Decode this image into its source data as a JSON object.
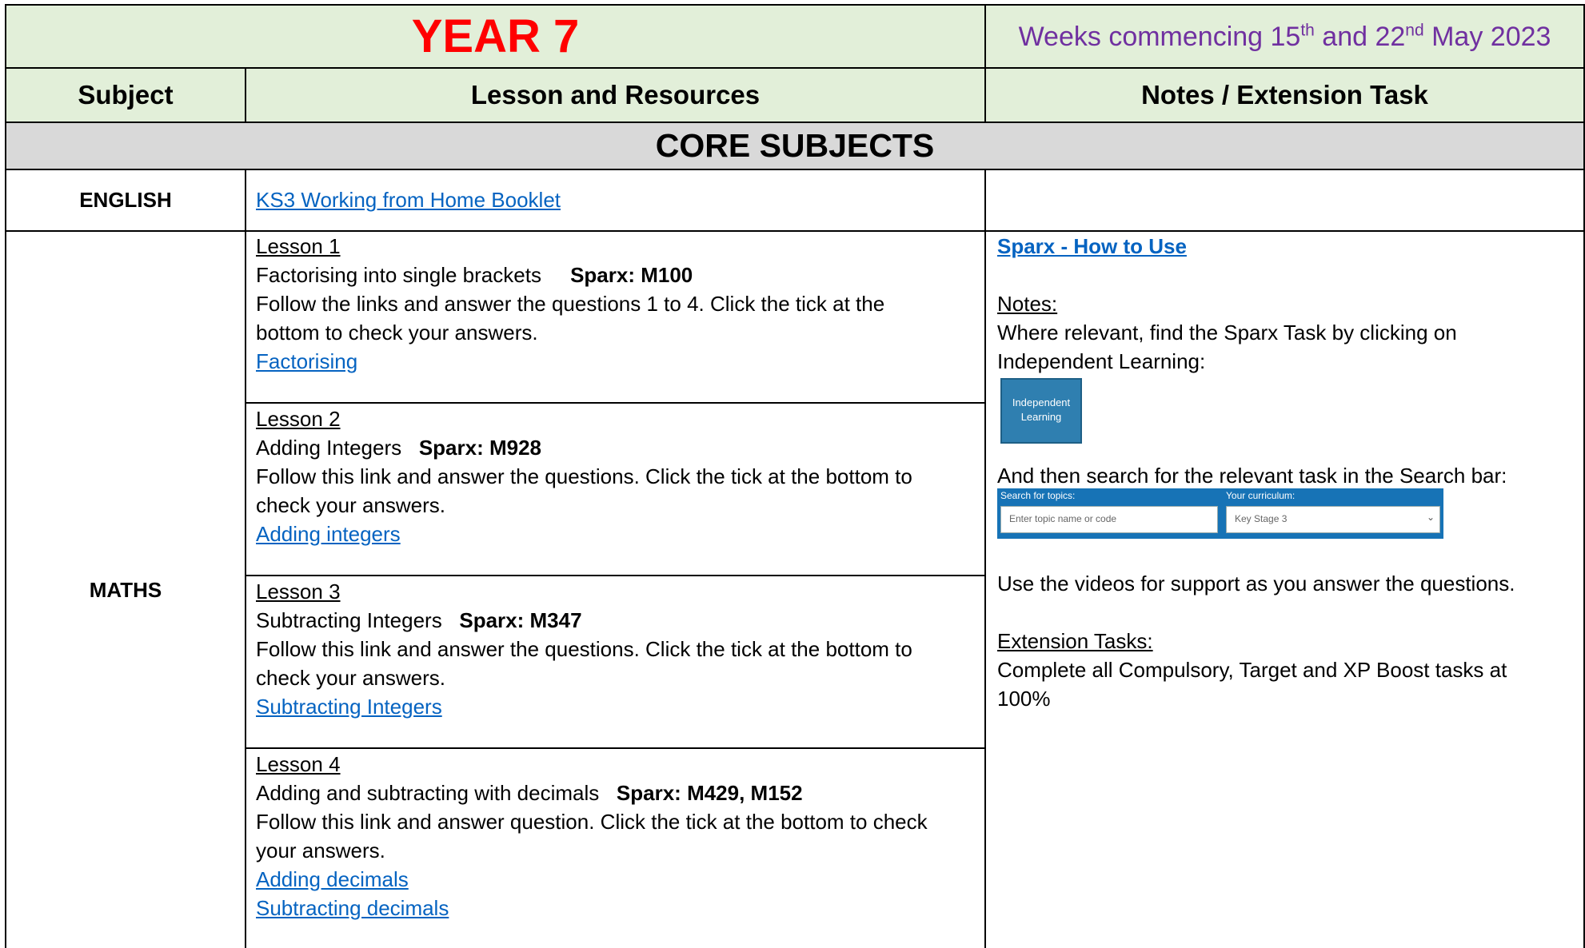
{
  "header": {
    "year_title": "YEAR 7",
    "weeks_prefix": "Weeks commencing 15",
    "weeks_sup1": "th",
    "weeks_mid": " and 22",
    "weeks_sup2": "nd",
    "weeks_suffix": " May 2023"
  },
  "columns": {
    "subject": "Subject",
    "lesson": "Lesson and Resources",
    "notes": "Notes / Extension Task"
  },
  "section_title": "CORE SUBJECTS",
  "english": {
    "subject": "ENGLISH",
    "link": "KS3 Working from Home Booklet"
  },
  "maths": {
    "subject": "MATHS",
    "lessons": [
      {
        "title": "Lesson 1",
        "topic": "Factorising into single brackets",
        "sparx": "Sparx: M100",
        "line1": "Follow the links and answer the questions 1 to 4. Click the tick at the",
        "line2": "bottom to check your answers.",
        "links": [
          "Factorising"
        ]
      },
      {
        "title": "Lesson 2",
        "topic": "Adding Integers",
        "sparx": "Sparx: M928",
        "line1": "Follow this link and answer the questions. Click the tick at the bottom to",
        "line2": "check your answers.",
        "links": [
          "Adding integers"
        ]
      },
      {
        "title": "Lesson 3",
        "topic": "Subtracting Integers",
        "sparx": "Sparx: M347",
        "line1": "Follow this link and answer the questions. Click the tick at the bottom to",
        "line2": "check your answers.",
        "links": [
          "Subtracting Integers"
        ]
      },
      {
        "title": "Lesson 4",
        "topic": "Adding and subtracting with decimals",
        "sparx": "Sparx: M429, M152",
        "line1": "Follow this link and answer question. Click the tick at the bottom to check",
        "line2": "your answers.",
        "links": [
          "Adding decimals",
          "Subtracting decimals"
        ]
      }
    ],
    "notes": {
      "how_to_link": "Sparx - How to Use",
      "notes_heading": "Notes:",
      "notes_line1": "Where relevant, find the Sparx Task by clicking on",
      "notes_line2": "Independent Learning:",
      "il_button_line1": "Independent",
      "il_button_line2": "Learning",
      "search_line": "And then search for the relevant task in the Search bar:",
      "search_label_topics": "Search for topics:",
      "search_label_curriculum": "Your curriculum:",
      "search_placeholder": "Enter topic name or code",
      "curriculum_value": "Key Stage 3",
      "videos_line": "Use the videos for support as you answer the questions.",
      "extension_heading": "Extension Tasks:",
      "extension_line1": "Complete all Compulsory, Target and XP Boost tasks at",
      "extension_line2": "100%"
    }
  },
  "colors": {
    "header_green": "#e2efd9",
    "section_grey": "#d9d9d9",
    "year_red": "#ff0000",
    "weeks_purple": "#7030a0",
    "link_blue": "#0563c1"
  }
}
